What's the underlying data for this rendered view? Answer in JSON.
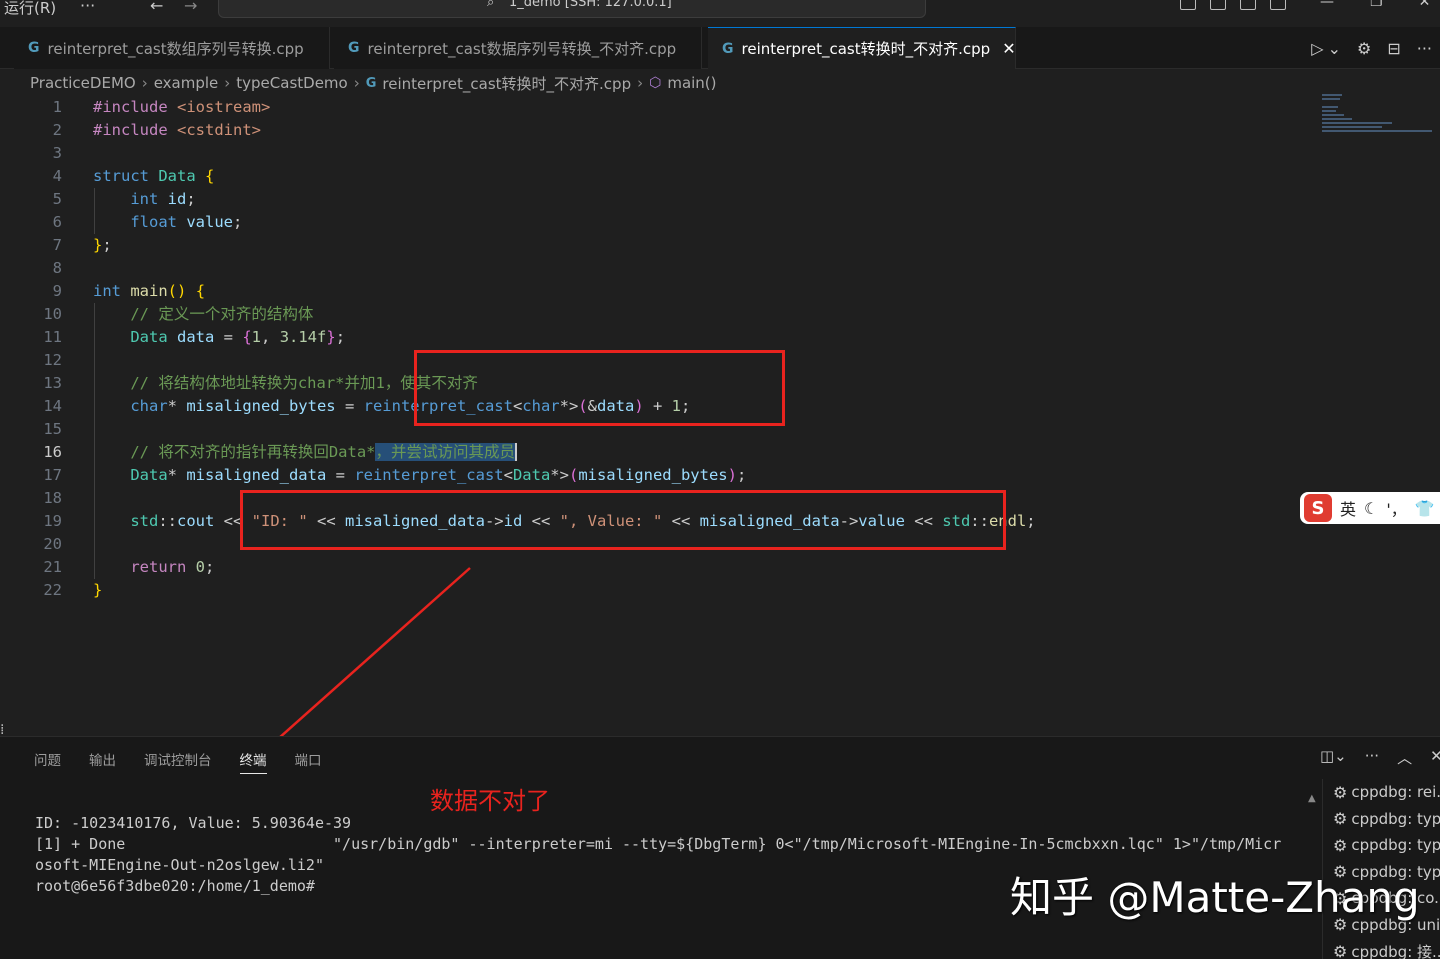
{
  "titlebar": {
    "menu_run": "运行(R)",
    "menu_more": "···",
    "nav_back": "←",
    "nav_forward": "→",
    "command_center": "1_demo [SSH: 127.0.0.1]"
  },
  "tabs": [
    {
      "label": "reinterpret_cast数组序列号转换.cpp",
      "active": false
    },
    {
      "label": "reinterpret_cast数据序列号转换_不对齐.cpp",
      "active": false
    },
    {
      "label": "reinterpret_cast转换时_不对齐.cpp",
      "active": true
    }
  ],
  "editor_actions": {
    "run": "▷",
    "run_dropdown": "⌄",
    "settings": "⚙",
    "split": "⊟",
    "more": "···"
  },
  "breadcrumb": [
    "PracticeDEMO",
    "example",
    "typeCastDemo",
    "reinterpret_cast转换时_不对齐.cpp",
    "main()"
  ],
  "code_lines": [
    "1",
    "2",
    "3",
    "4",
    "5",
    "6",
    "7",
    "8",
    "9",
    "10",
    "11",
    "12",
    "13",
    "14",
    "15",
    "16",
    "17",
    "18",
    "19",
    "20",
    "21",
    "22"
  ],
  "panel": {
    "tabs": [
      "问题",
      "输出",
      "调试控制台",
      "终端",
      "端口"
    ],
    "active_tab": "终端",
    "annotation": "数据不对了",
    "terminal_lines": [
      "ID: -1023410176, Value: 5.90364e-39",
      "[1] + Done                       \"/usr/bin/gdb\" --interpreter=mi --tty=${DbgTerm} 0<\"/tmp/Microsoft-MIEngine-In-5cmcbxxn.lqc\" 1>\"/tmp/Micr",
      "osoft-MIEngine-Out-n2oslgew.li2\"",
      "root@6e56f3dbe020:/home/1_demo#"
    ],
    "terminal_list": [
      "cppdbg: rei...",
      "cppdbg: typ...",
      "cppdbg: typ...",
      "cppdbg: typ...",
      "cppdbg: co...",
      "cppdbg: uni...",
      "cppdbg: 接..."
    ]
  },
  "ime": {
    "logo": "S",
    "mode": "英"
  },
  "watermark": "知乎 @Matte-Zhang"
}
